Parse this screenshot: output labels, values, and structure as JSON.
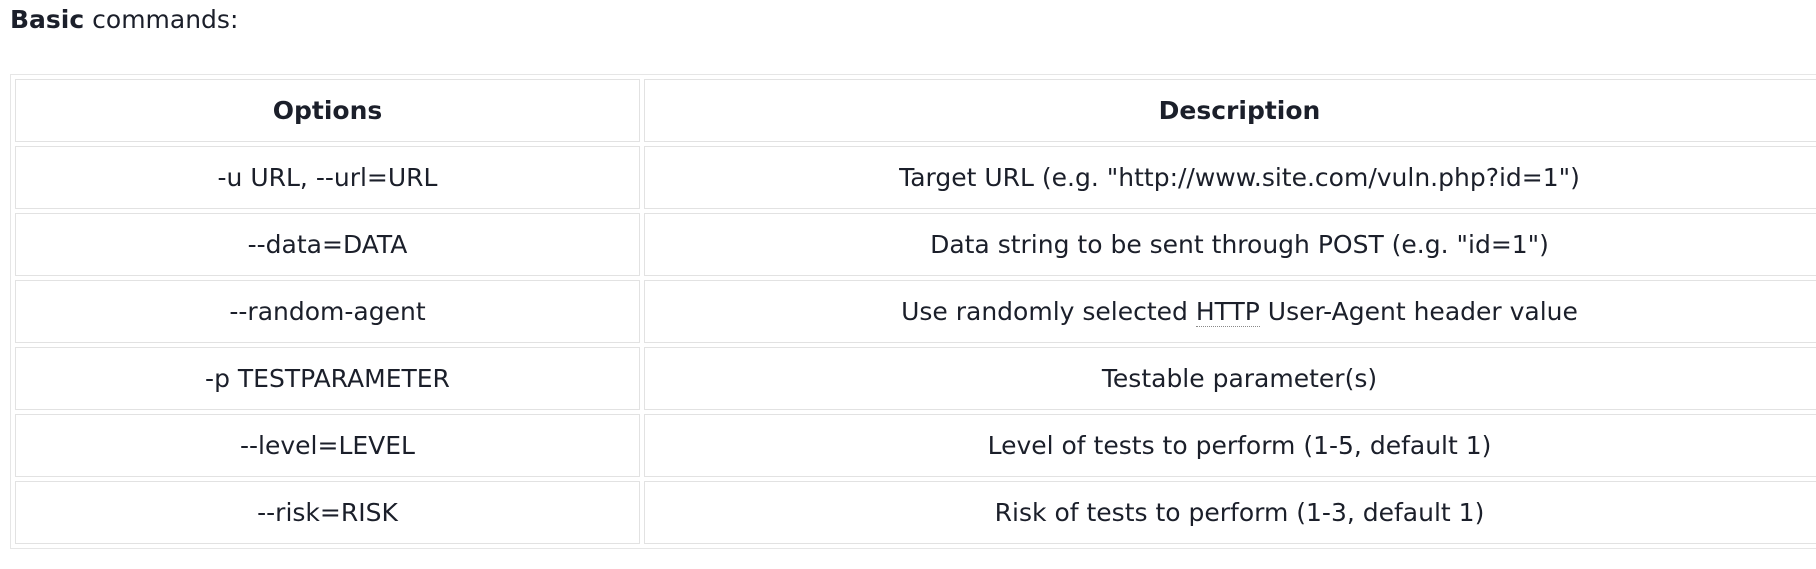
{
  "heading": {
    "bold": "Basic",
    "rest": " commands:"
  },
  "table": {
    "headers": [
      "Options",
      "Description"
    ],
    "rows": [
      {
        "option": "-u URL, --url=URL",
        "description": "Target URL (e.g. \"http://www.site.com/vuln.php?id=1\")"
      },
      {
        "option": "--data=DATA",
        "description": "Data string to be sent through POST (e.g. \"id=1\")"
      },
      {
        "option": "--random-agent",
        "description_pre": "Use randomly selected ",
        "description_abbr": "HTTP",
        "description_post": " User-Agent header value"
      },
      {
        "option": "-p TESTPARAMETER",
        "description": "Testable parameter(s)"
      },
      {
        "option": "--level=LEVEL",
        "description": "Level of tests to perform (1-5, default 1)"
      },
      {
        "option": "--risk=RISK",
        "description": "Risk of tests to perform (1-3, default 1)"
      }
    ]
  }
}
